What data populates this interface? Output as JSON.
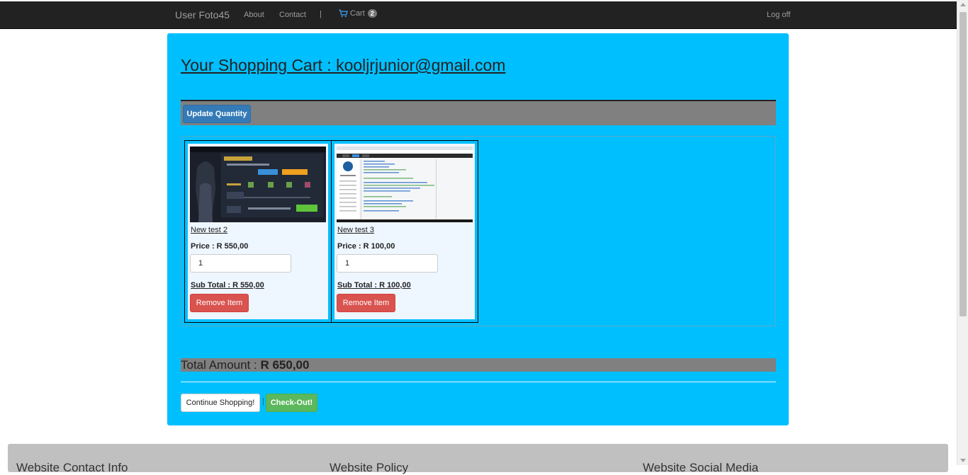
{
  "nav": {
    "brand": "User Foto45",
    "about": "About",
    "contact": "Contact",
    "separator": "|",
    "cart_label": "Cart",
    "cart_count": "2",
    "logoff": "Log off"
  },
  "cart": {
    "title": "Your Shopping Cart : kooljrjunior@gmail.com",
    "update_button": "Update Quantity",
    "items": [
      {
        "name": "New test 2",
        "price": "Price : R 550,00",
        "quantity": "1",
        "subtotal": "Sub Total : R 550,00",
        "remove_button": "Remove Item"
      },
      {
        "name": "New test 3",
        "price": "Price : R 100,00",
        "quantity": "1",
        "subtotal": "Sub Total : R 100,00",
        "remove_button": "Remove Item"
      }
    ],
    "total_label": "Total Amount :",
    "total_value": "R 650,00",
    "continue_button": "Continue Shopping!",
    "divider": "|",
    "checkout_button": "Check-Out!"
  },
  "footer": {
    "col1": "Website Contact Info",
    "col2": "Website Policy",
    "col3": "Website Social Media"
  },
  "colors": {
    "panel": "#00bfff",
    "navbar": "#222222",
    "toolbar": "#808080",
    "primary": "#337ab7",
    "danger": "#d9534f",
    "success": "#5cb85c"
  }
}
